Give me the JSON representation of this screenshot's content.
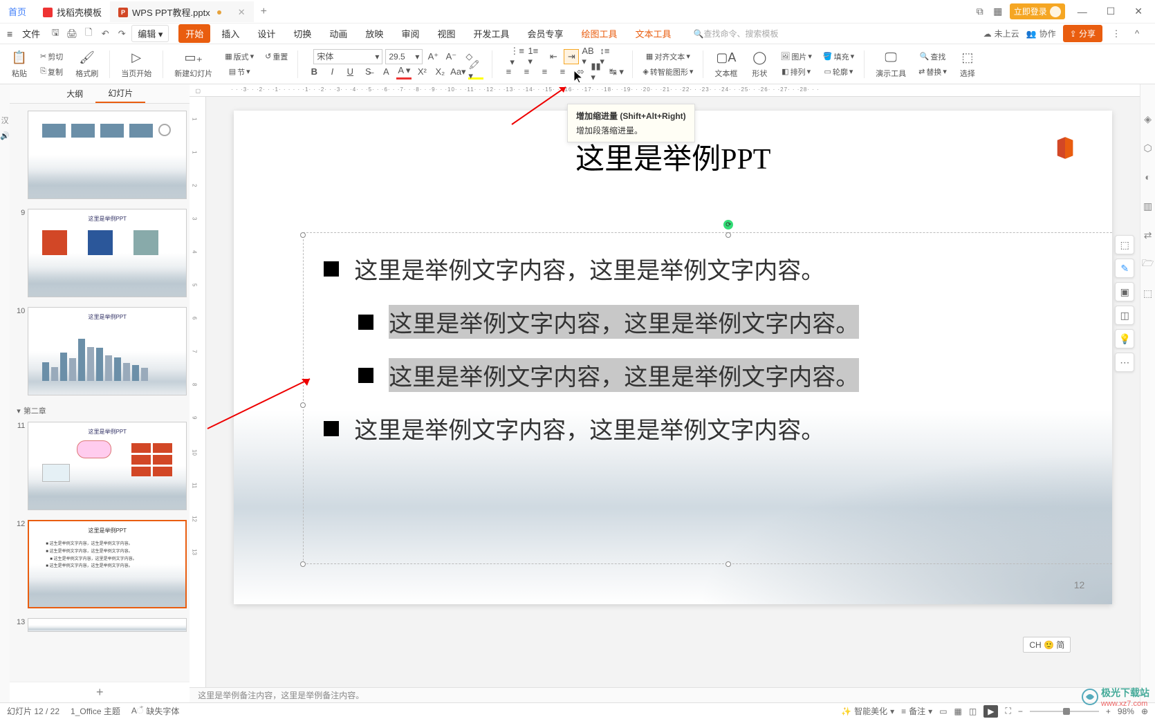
{
  "tabs": {
    "home": "首页",
    "template": "找稻壳模板",
    "doc": "WPS PPT教程.pptx"
  },
  "titlebar": {
    "login": "立即登录"
  },
  "menubar": {
    "file": "文件",
    "edit": "编辑",
    "tabs": [
      "开始",
      "插入",
      "设计",
      "切换",
      "动画",
      "放映",
      "审阅",
      "视图",
      "开发工具",
      "会员专享",
      "绘图工具",
      "文本工具"
    ],
    "search_placeholder": "查找命令、搜索模板",
    "cloud": "未上云",
    "collab": "协作",
    "share": "分享"
  },
  "ribbon": {
    "paste": "粘贴",
    "cut": "剪切",
    "copy": "复制",
    "format_painter": "格式刷",
    "from_current": "当页开始",
    "new_slide": "新建幻灯片",
    "layout": "版式",
    "section": "节",
    "reset": "重置",
    "font_name": "宋体",
    "font_size": "29.5",
    "align_text": "对齐文本",
    "smart_graphic": "转智能图形",
    "textbox": "文本框",
    "shape": "形状",
    "picture": "图片",
    "arrange": "排列",
    "fill": "填充",
    "outline": "轮廓",
    "presentation": "演示工具",
    "find": "查找",
    "replace": "替换",
    "select": "选择"
  },
  "panel": {
    "tab1": "大纲",
    "tab2": "幻灯片",
    "section2": "第二章"
  },
  "slide": {
    "title": "这里是举例PPT",
    "lines": [
      "这里是举例文字内容，这里是举例文字内容。",
      "这里是举例文字内容，这里是举例文字内容。",
      "这里是举例文字内容，这里是举例文字内容。",
      "这里是举例文字内容，这里是举例文字内容。"
    ],
    "number": "12"
  },
  "tooltip": {
    "title": "增加缩进量 (Shift+Alt+Right)",
    "body": "增加段落缩进量。"
  },
  "thumb_titles": {
    "t9": "这里是举例PPT",
    "t10": "这里是举例PPT",
    "t11": "这里是举例PPT",
    "t12": "这里是举例PPT",
    "t12_lines": [
      "这生是举例文字内容，这生是举例文字内容。",
      "这生是举例文字内容，这生是举例文字内容。",
      "这生是举例文字内容，这里是举例文字内容。",
      "这生是举例文字内容，这生是举例文字内容。"
    ]
  },
  "notes": "这里是举例备注内容，这里是举例备注内容。",
  "ime": "CH 🙂 简",
  "status": {
    "slide_count": "幻灯片 12 / 22",
    "theme": "1_Office 主题",
    "missing_font": "缺失字体",
    "beautify": "智能美化",
    "notes": "备注",
    "zoom": "98%"
  },
  "watermark": {
    "brand": "极光下载站",
    "url": "www.xz7.com"
  }
}
